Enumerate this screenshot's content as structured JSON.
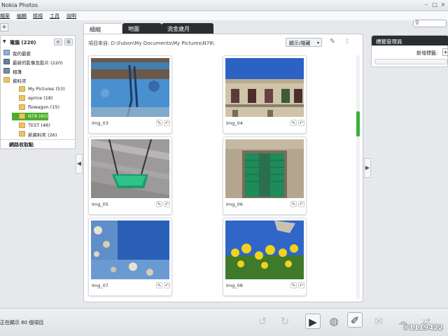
{
  "window": {
    "title": "Nokia Photos",
    "minimize": "–",
    "maximize": "□",
    "close": "×"
  },
  "menu": [
    "檔案",
    "編輯",
    "檢視",
    "工具",
    "說明"
  ],
  "search": {
    "icon": "search-icon",
    "glyph": "⚲",
    "value": ""
  },
  "sidebar": {
    "add": "+",
    "root": "電腦 (220)",
    "view_list": "≡",
    "view_grid": "⊞",
    "items": [
      {
        "label": "我的最愛",
        "icon": "favorites-icon"
      },
      {
        "label": "最新的影像及影片 (220)",
        "icon": "recent-icon"
      },
      {
        "label": "相簿",
        "icon": "album-icon"
      },
      {
        "label": "資料夾",
        "icon": "folder-icon"
      },
      {
        "label": "My Pictures (53)",
        "icon": "folder-icon"
      },
      {
        "label": "eprice (18)",
        "icon": "folder-icon"
      },
      {
        "label": "flowagon (15)",
        "icon": "folder-icon"
      },
      {
        "label": "N78 (60)",
        "icon": "folder-icon",
        "selected": true
      },
      {
        "label": "TEST (48)",
        "icon": "folder-icon"
      },
      {
        "label": "新資料夾 (26)",
        "icon": "folder-icon"
      }
    ],
    "network": "網路收取點"
  },
  "tabs": [
    "細縮",
    "地圖",
    "流金歲月"
  ],
  "toolbar": {
    "path_label": "項目來自: D:\\Fubon\\My Documents\\My Pictures\\N78\\",
    "show_hide": "顯示/隱藏",
    "show_hide_arrow": "▾",
    "wand_glyph": "✎",
    "upload_glyph": "⇪"
  },
  "photos": [
    {
      "caption": "Img_03",
      "scene": "blue-boat"
    },
    {
      "caption": "Img_04",
      "scene": "building"
    },
    {
      "caption": "Img_05",
      "scene": "swing"
    },
    {
      "caption": "Img_06",
      "scene": "shutters"
    },
    {
      "caption": "Img_07",
      "scene": "peeling-wall"
    },
    {
      "caption": "Img_08",
      "scene": "flowers"
    }
  ],
  "photo_actions": {
    "edit": "✎",
    "rotate": "↶"
  },
  "pane_toggles": {
    "left": "◀",
    "right": "▶"
  },
  "tag_manager": {
    "title": "標籤管理員",
    "new_tag_label": "新增標籤:",
    "add": "+"
  },
  "status": {
    "text": "正在顯示 60 個項目"
  },
  "bottom_icons": [
    {
      "name": "rotate-left-icon",
      "glyph": "↺",
      "state": "dim"
    },
    {
      "name": "rotate-right-icon",
      "glyph": "↻",
      "state": "dim"
    },
    {
      "name": "slideshow-icon",
      "glyph": "▶",
      "state": "framed"
    },
    {
      "name": "globe-icon",
      "glyph": "◍",
      "state": "normal"
    },
    {
      "name": "tag-icon",
      "glyph": "✐",
      "state": "framed"
    },
    {
      "name": "email-icon",
      "glyph": "✉",
      "state": "dim"
    },
    {
      "name": "share-icon",
      "glyph": "☁",
      "state": "dim"
    },
    {
      "name": "sync-icon",
      "glyph": "⇄",
      "state": "dim"
    }
  ],
  "watermark": "#1119422",
  "colors": {
    "accent": "#4caf2c",
    "dark_tab": "#2b2d31",
    "scroll_thumb": "#3ab23a"
  }
}
